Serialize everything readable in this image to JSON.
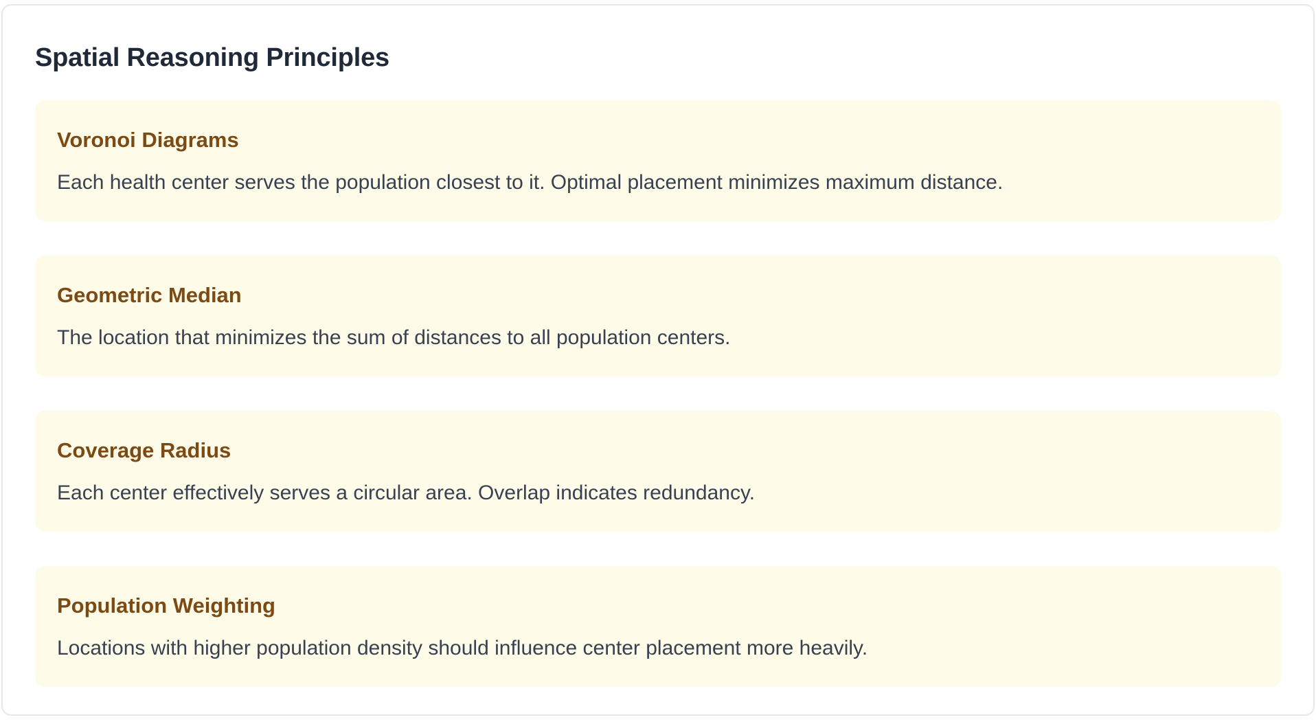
{
  "panel": {
    "title": "Spatial Reasoning Principles",
    "cards": [
      {
        "title": "Voronoi Diagrams",
        "text": "Each health center serves the population closest to it. Optimal placement minimizes maximum distance."
      },
      {
        "title": "Geometric Median",
        "text": "The location that minimizes the sum of distances to all population centers."
      },
      {
        "title": "Coverage Radius",
        "text": "Each center effectively serves a circular area. Overlap indicates redundancy."
      },
      {
        "title": "Population Weighting",
        "text": "Locations with higher population density should influence center placement more heavily."
      }
    ]
  },
  "colors": {
    "card_background": "#fefce8",
    "card_title": "#7c4a14",
    "panel_title": "#1f2937",
    "body_text": "#374151",
    "panel_border": "#e5e7eb"
  }
}
